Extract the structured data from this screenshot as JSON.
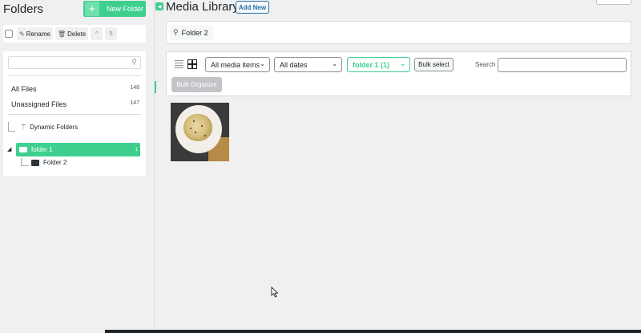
{
  "sidebar": {
    "title": "Folders",
    "new_folder_label": "New Folder",
    "toolbar": {
      "rename_label": "Rename",
      "delete_label": "Delete"
    },
    "search_placeholder": "",
    "all_files": {
      "label": "All Files",
      "count": "148"
    },
    "unassigned_files": {
      "label": "Unassigned Files",
      "count": "147"
    },
    "dynamic_folders_label": "Dynamic Folders",
    "folders": [
      {
        "label": "folder 1",
        "count": "1",
        "active": true
      },
      {
        "label": "Folder 2",
        "count": "",
        "active": false
      }
    ]
  },
  "main": {
    "title": "Media Library",
    "add_new_label": "Add New",
    "breadcrumb": "Folder 2",
    "filters": {
      "media_type": "All media items",
      "dates": "All dates",
      "folder": "folder 1 (1)",
      "bulk_select_label": "Bulk select",
      "search_label": "Search",
      "search_value": "",
      "bulk_organize_label": "Bulk Organize"
    },
    "items": [
      {
        "icon": "pasta-photo"
      }
    ]
  },
  "colors": {
    "accent_green": "#3ecf8e",
    "wp_blue": "#2271b1",
    "background": "#f0f0f1"
  }
}
